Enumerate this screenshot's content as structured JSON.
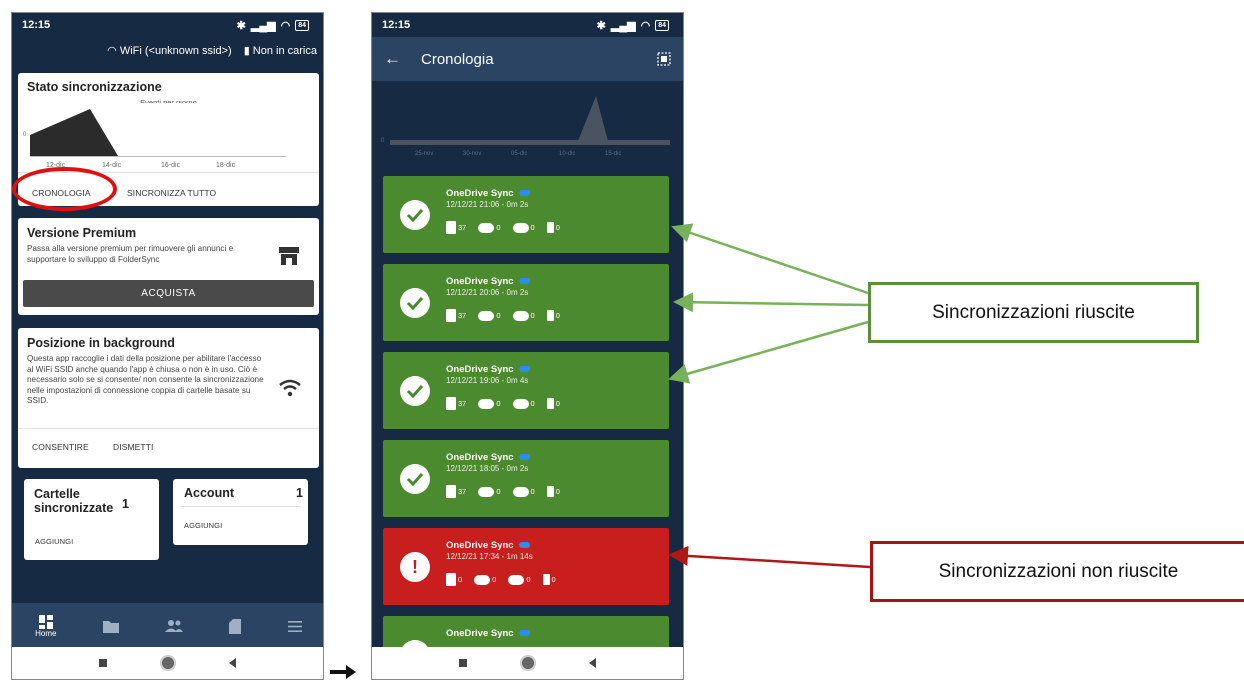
{
  "status": {
    "time": "12:15",
    "battery": "84"
  },
  "left": {
    "wifi": "WiFi (<unknown ssid>)",
    "charging": "Non in carica",
    "sync_card": {
      "title": "Stato sincronizzazione",
      "chart_caption": "Eventi per giorno",
      "y_zero": "0",
      "ticks": [
        "12-dic",
        "14-dic",
        "16-dic",
        "18-dic"
      ],
      "link1": "CRONOLOGIA",
      "link2": "SINCRONIZZA TUTTO"
    },
    "premium": {
      "title": "Versione Premium",
      "text": "Passa alla versione premium per rimuovere gli annunci e supportare lo sviluppo di FolderSync",
      "button": "ACQUISTA"
    },
    "location": {
      "title": "Posizione in background",
      "text": "Questa app raccoglie i dati della posizione per abilitare l'accesso al WiFi SSID anche quando l'app è chiusa o non è in uso. Ciò è necessario solo se si consente/ non consente la sincronizzazione nelle impostazioni di connessione coppia di cartelle basate su SSID.",
      "allow": "CONSENTIRE",
      "dismiss": "DISMETTI"
    },
    "folders": {
      "title": "Cartelle sincronizzate",
      "count": "1",
      "add": "AGGIUNGI"
    },
    "account": {
      "title": "Account",
      "count": "1",
      "add": "AGGIUNGI"
    },
    "nav": {
      "home": "Home"
    }
  },
  "right": {
    "title": "Cronologia",
    "chart": {
      "y_zero": "0",
      "ticks": [
        "25-nov",
        "30-nov",
        "05-dic",
        "10-dic",
        "15-dic"
      ]
    },
    "items": [
      {
        "name": "OneDrive Sync",
        "date": "12/12/21 21:06 - 0m 2s",
        "files": "37",
        "down": "0",
        "up": "0",
        "del": "0",
        "status": "ok"
      },
      {
        "name": "OneDrive Sync",
        "date": "12/12/21 20:06 - 0m 2s",
        "files": "37",
        "down": "0",
        "up": "0",
        "del": "0",
        "status": "ok"
      },
      {
        "name": "OneDrive Sync",
        "date": "12/12/21 19:06 - 0m 4s",
        "files": "37",
        "down": "0",
        "up": "0",
        "del": "0",
        "status": "ok"
      },
      {
        "name": "OneDrive Sync",
        "date": "12/12/21 18:05 - 0m 2s",
        "files": "37",
        "down": "0",
        "up": "0",
        "del": "0",
        "status": "ok"
      },
      {
        "name": "OneDrive Sync",
        "date": "12/12/21 17:34 - 1m 14s",
        "files": "0",
        "down": "0",
        "up": "0",
        "del": "0",
        "status": "error"
      },
      {
        "name": "OneDrive Sync",
        "status": "ok"
      }
    ]
  },
  "callouts": {
    "success": "Sincronizzazioni riuscite",
    "failure": "Sincronizzazioni non riuscite"
  },
  "colors": {
    "success": "#4c8a2f",
    "error": "#c81e1e",
    "background": "#172a44",
    "highlight": "#e01010"
  }
}
